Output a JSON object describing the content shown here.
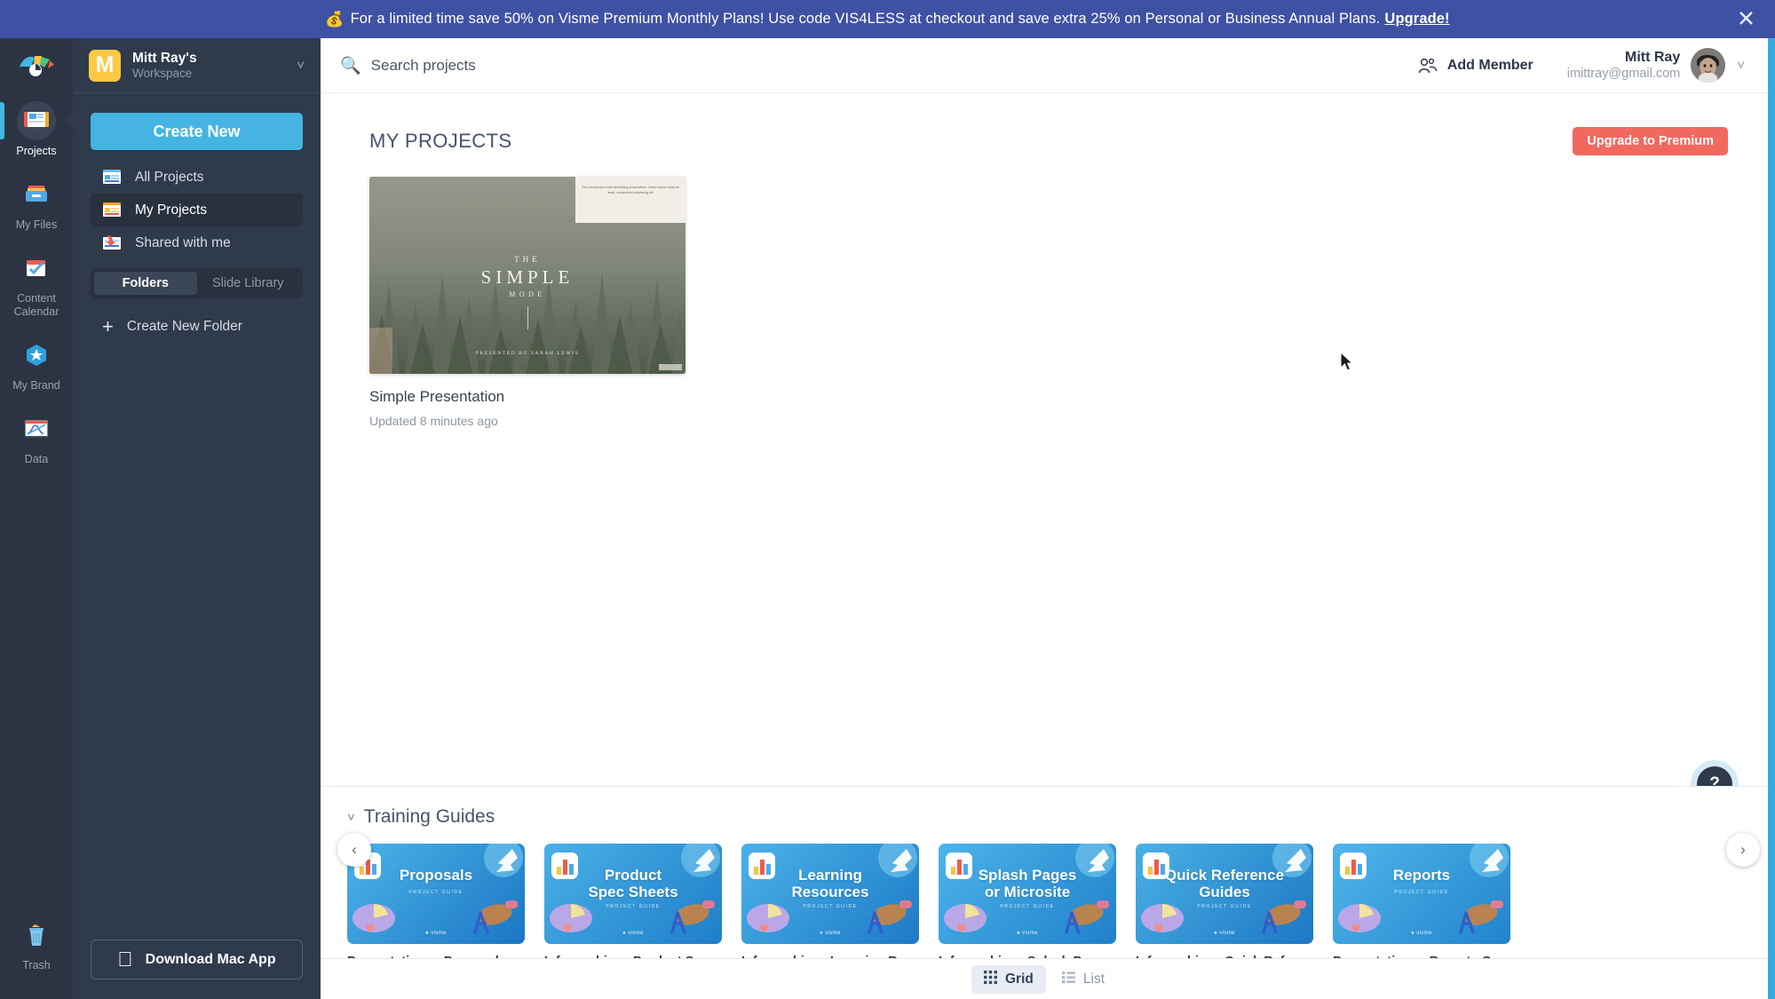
{
  "promo": {
    "icon": "money-bag-icon",
    "text": "For a limited time save 50% on Visme Premium Monthly Plans!  Use code VIS4LESS at checkout and save extra 25% on Personal or Business Annual Plans.",
    "link_label": "Upgrade!",
    "close_label": "✕",
    "bg_color": "#3f51a3"
  },
  "rail": {
    "logo_name": "visme-logo-icon",
    "items": [
      {
        "label": "Projects",
        "icon": "projects-icon",
        "active": true
      },
      {
        "label": "My Files",
        "icon": "my-files-icon",
        "active": false
      },
      {
        "label": "Content Calendar",
        "icon": "content-calendar-icon",
        "active": false
      },
      {
        "label": "My Brand",
        "icon": "my-brand-icon",
        "active": false
      },
      {
        "label": "Data",
        "icon": "data-icon",
        "active": false
      }
    ],
    "trash": {
      "label": "Trash",
      "icon": "trash-icon"
    }
  },
  "sidebar": {
    "workspace": {
      "initial": "M",
      "name": "Mitt Ray's",
      "subtitle": "Workspace",
      "chevron": "˅",
      "avatar_color": "#ffc844"
    },
    "create_new_label": "Create New",
    "nav": [
      {
        "label": "All Projects",
        "icon": "all-projects-icon",
        "active": false
      },
      {
        "label": "My Projects",
        "icon": "my-projects-icon",
        "active": true
      },
      {
        "label": "Shared with me",
        "icon": "shared-with-me-icon",
        "active": false
      }
    ],
    "segments": [
      {
        "label": "Folders",
        "active": true
      },
      {
        "label": "Slide Library",
        "active": false
      }
    ],
    "create_folder_label": "Create New Folder",
    "create_folder_plus": "+",
    "mac_app_label": "Download Mac App",
    "mac_app_icon": "apple-icon"
  },
  "topbar": {
    "search_placeholder": "Search projects",
    "search_value": "",
    "search_icon": "magnifier-icon",
    "add_member_label": "Add Member",
    "add_member_icon": "add-member-icon",
    "user_name": "Mitt Ray",
    "user_email": "imittray@gmail.com",
    "user_chevron": "˅"
  },
  "main": {
    "page_title": "MY PROJECTS",
    "upgrade_label": "Upgrade to Premium",
    "upgrade_color": "#f1685e",
    "help_label": "?",
    "projects": [
      {
        "title": "Simple Presentation",
        "updated": "Updated 8 minutes ago",
        "thumb": {
          "line1": "THE",
          "line2": "SIMPLE",
          "line3": "MODE",
          "presenter": "PRESENTED BY SARAH LEWIS",
          "note": "Few introduction here describing presentation. Lorem ipsum dolor sit amet, consectetur adipiscing elit"
        }
      }
    ]
  },
  "training": {
    "title": "Training Guides",
    "chevron": "˅",
    "prev_arrow": "‹",
    "next_arrow": "›",
    "guides": [
      {
        "label": "Presentations - Proposals Guide",
        "thumb_title": "Proposals",
        "thumb_sub": "PROJECT GUIDE",
        "brand": "visme"
      },
      {
        "label": "Infographics - Product Spec Sheets",
        "thumb_title": "Product\nSpec Sheets",
        "thumb_sub": "PROJECT GUIDE",
        "brand": "visme"
      },
      {
        "label": "Infographics - Learning Resources",
        "thumb_title": "Learning\nResources",
        "thumb_sub": "PROJECT GUIDE",
        "brand": "visme"
      },
      {
        "label": "Infographics - Splash Pages",
        "thumb_title": "Splash Pages\nor Microsite",
        "thumb_sub": "PROJECT GUIDE",
        "brand": "visme"
      },
      {
        "label": "Infographics - Quick Reference Gu...",
        "thumb_title": "Quick Reference\nGuides",
        "thumb_sub": "PROJECT GUIDE",
        "brand": "visme"
      },
      {
        "label": "Presentations - Reports Guide",
        "thumb_title": "Reports",
        "thumb_sub": "PROJECT GUIDE",
        "brand": "visme"
      }
    ]
  },
  "bottombar": {
    "views": [
      {
        "label": "Grid",
        "icon": "grid-icon",
        "active": true
      },
      {
        "label": "List",
        "icon": "list-icon",
        "active": false
      }
    ]
  }
}
